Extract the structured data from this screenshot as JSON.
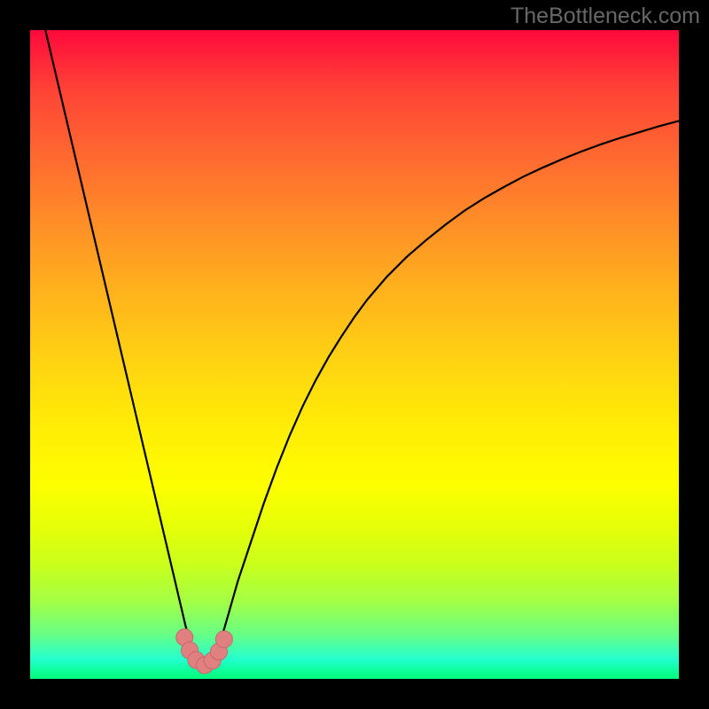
{
  "watermark": "TheBottleneck.com",
  "colors": {
    "frame": "#000000",
    "curve": "#000000",
    "marker_fill": "#e08080",
    "marker_edge": "#c86868",
    "gradient_stops": [
      {
        "pos": 0,
        "hex": "#fe093c"
      },
      {
        "pos": 9,
        "hex": "#ff4236"
      },
      {
        "pos": 20,
        "hex": "#ff6b30"
      },
      {
        "pos": 30,
        "hex": "#ff8f27"
      },
      {
        "pos": 40,
        "hex": "#ffb11d"
      },
      {
        "pos": 50,
        "hex": "#ffd013"
      },
      {
        "pos": 60,
        "hex": "#ffea07"
      },
      {
        "pos": 70,
        "hex": "#feff00"
      },
      {
        "pos": 76,
        "hex": "#e8ff07"
      },
      {
        "pos": 82,
        "hex": "#ccff1a"
      },
      {
        "pos": 88,
        "hex": "#a4ff44"
      },
      {
        "pos": 93,
        "hex": "#6aff84"
      },
      {
        "pos": 97,
        "hex": "#23ffce"
      },
      {
        "pos": 100,
        "hex": "#00ff78"
      }
    ]
  },
  "chart_data": {
    "type": "line",
    "title": "",
    "xlabel": "",
    "ylabel": "",
    "xlim": [
      0,
      100
    ],
    "ylim": [
      0,
      100
    ],
    "min_x": 27,
    "series": [
      {
        "name": "bottleneck-curve",
        "x": [
          0,
          2,
          4,
          6,
          8,
          10,
          12,
          14,
          16,
          18,
          20,
          21,
          22,
          23,
          24,
          25,
          26,
          27,
          28,
          29,
          30,
          31,
          32,
          34,
          36,
          38,
          40,
          42,
          44,
          46,
          48,
          50,
          52,
          55,
          58,
          61,
          64,
          67,
          70,
          73,
          76,
          79,
          82,
          85,
          88,
          91,
          94,
          97,
          100
        ],
        "y": [
          110,
          101.5,
          93,
          84.5,
          76,
          67.5,
          59,
          50.5,
          42,
          33.5,
          25,
          20.75,
          16.5,
          12.25,
          8,
          5,
          3,
          2,
          3,
          5,
          8,
          11.5,
          15,
          21,
          27,
          32.5,
          37.5,
          42,
          46,
          49.6,
          52.8,
          55.8,
          58.5,
          62,
          65,
          67.6,
          70,
          72.2,
          74.1,
          75.8,
          77.4,
          78.8,
          80.1,
          81.3,
          82.4,
          83.4,
          84.3,
          85.2,
          86
        ]
      }
    ],
    "markers": {
      "name": "optimal-range",
      "points": [
        {
          "x": 23.8,
          "y": 6.4
        },
        {
          "x": 24.6,
          "y": 4.4
        },
        {
          "x": 25.6,
          "y": 2.9
        },
        {
          "x": 26.9,
          "y": 2.1
        },
        {
          "x": 28.1,
          "y": 2.8
        },
        {
          "x": 29.1,
          "y": 4.2
        },
        {
          "x": 29.9,
          "y": 6.1
        }
      ]
    }
  }
}
